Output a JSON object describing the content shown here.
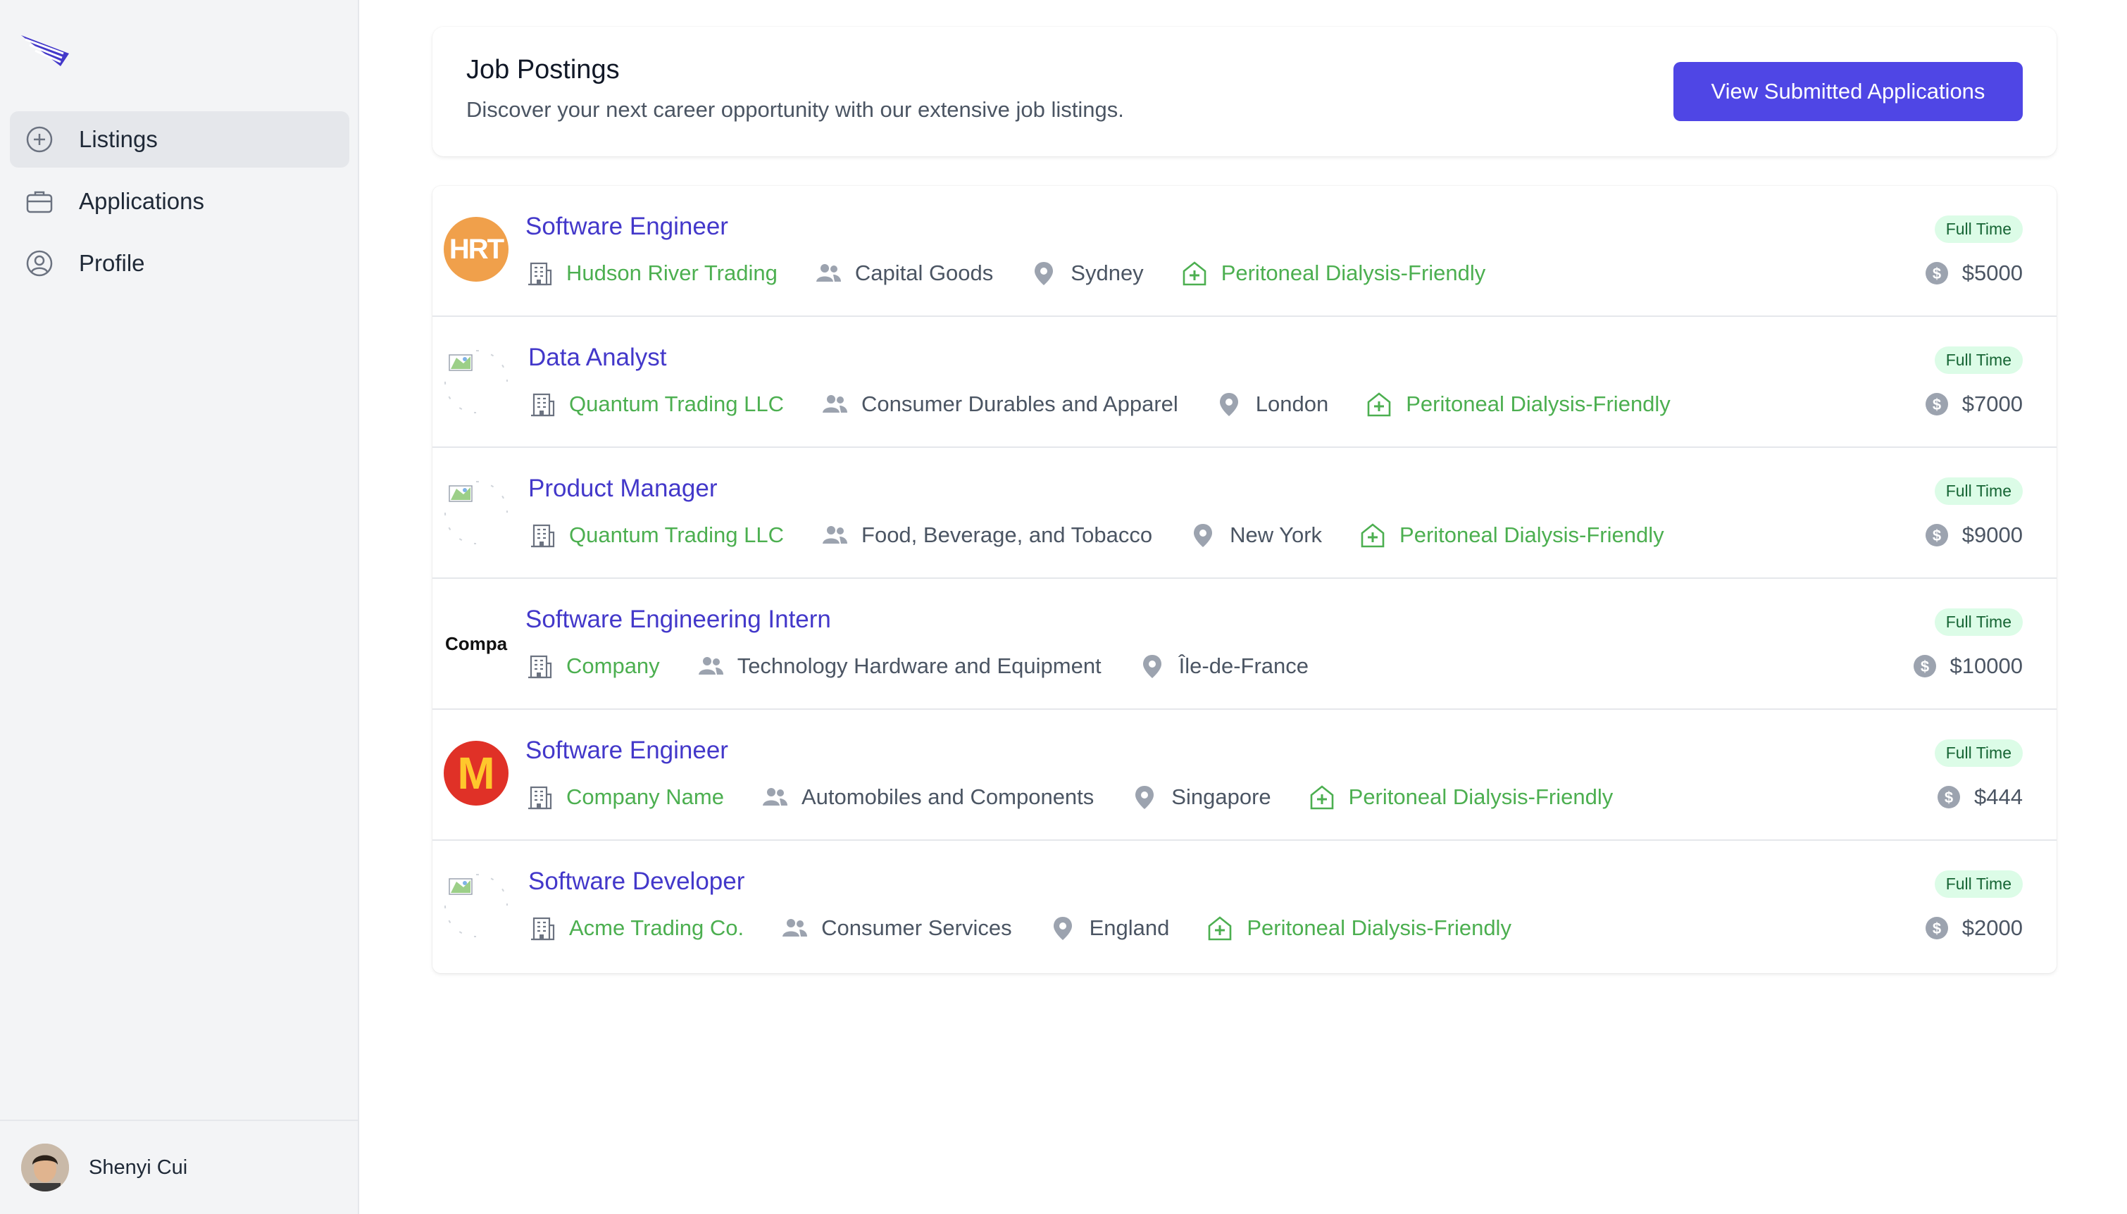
{
  "sidebar": {
    "items": [
      {
        "label": "Listings",
        "icon": "plus-circle-icon",
        "active": true
      },
      {
        "label": "Applications",
        "icon": "briefcase-icon",
        "active": false
      },
      {
        "label": "Profile",
        "icon": "user-circle-icon",
        "active": false
      }
    ],
    "user": {
      "name": "Shenyi Cui"
    }
  },
  "header": {
    "title": "Job Postings",
    "subtitle": "Discover your next career opportunity with our extensive job listings.",
    "button_label": "View Submitted Applications"
  },
  "jobs": [
    {
      "title": "Software Engineer",
      "company": "Hudson River Trading",
      "industry": "Capital Goods",
      "location": "Sydney",
      "pd": "Peritoneal Dialysis-Friendly",
      "type": "Full Time",
      "salary": "$5000",
      "logo_text": "HRT"
    },
    {
      "title": "Data Analyst",
      "company": "Quantum Trading LLC",
      "industry": "Consumer Durables and Apparel",
      "location": "London",
      "pd": "Peritoneal Dialysis-Friendly",
      "type": "Full Time",
      "salary": "$7000"
    },
    {
      "title": "Product Manager",
      "company": "Quantum Trading LLC",
      "industry": "Food, Beverage, and Tobacco",
      "location": "New York",
      "pd": "Peritoneal Dialysis-Friendly",
      "type": "Full Time",
      "salary": "$9000"
    },
    {
      "title": "Software Engineering Intern",
      "company": "Company",
      "industry": "Technology Hardware and Equipment",
      "location": "Île-de-France",
      "pd": "",
      "type": "Full Time",
      "salary": "$10000",
      "logo_text": "Compa"
    },
    {
      "title": "Software Engineer",
      "company": "Company Name",
      "industry": "Automobiles and Components",
      "location": "Singapore",
      "pd": "Peritoneal Dialysis-Friendly",
      "type": "Full Time",
      "salary": "$444",
      "logo_text": "M"
    },
    {
      "title": "Software Developer",
      "company": "Acme Trading Co.",
      "industry": "Consumer Services",
      "location": "England",
      "pd": "Peritoneal Dialysis-Friendly",
      "type": "Full Time",
      "salary": "$2000"
    }
  ],
  "colors": {
    "accent": "#4f46e5",
    "title": "#4338ca",
    "green": "#4caf50",
    "badge_bg": "#dcfce7",
    "badge_text": "#166534"
  }
}
